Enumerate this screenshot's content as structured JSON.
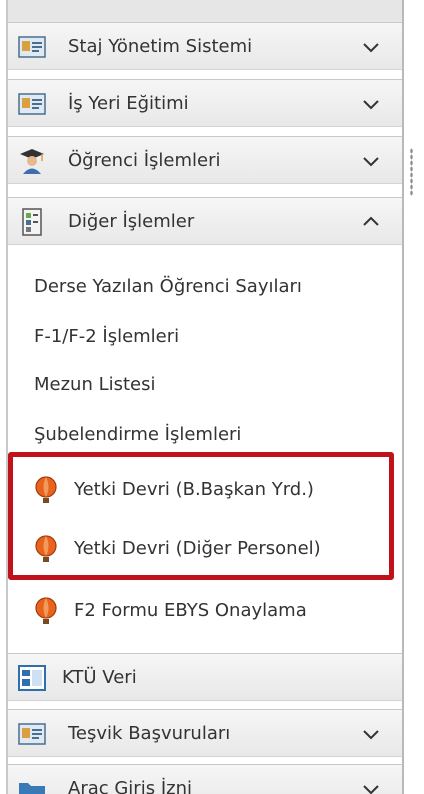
{
  "menu": {
    "sections_top": [
      {
        "label": "Staj Yönetim Sistemi",
        "icon": "card-icon",
        "state": "collapsed"
      },
      {
        "label": "İş Yeri Eğitimi",
        "icon": "card-icon",
        "state": "collapsed"
      },
      {
        "label": "Öğrenci İşlemleri",
        "icon": "graduate-icon",
        "state": "collapsed"
      },
      {
        "label": "Diğer İşlemler",
        "icon": "document-icon",
        "state": "expanded"
      }
    ],
    "items": [
      {
        "label": "Derse Yazılan Öğrenci Sayıları"
      },
      {
        "label": "F-1/F-2 İşlemleri"
      },
      {
        "label": "Mezun Listesi"
      },
      {
        "label": "Şubelendirme İşlemleri"
      },
      {
        "label": "Yetki Devri (B.Başkan Yrd.)",
        "icon": "balloon-icon"
      },
      {
        "label": "Yetki Devri (Diğer Personel)",
        "icon": "balloon-icon"
      },
      {
        "label": "F2 Formu EBYS Onaylama",
        "icon": "balloon-icon"
      }
    ],
    "sections_bottom": [
      {
        "label": "KTÜ Veri",
        "icon": "grid-window-icon"
      },
      {
        "label": "Teşvik Başvuruları",
        "icon": "card-icon",
        "state": "collapsed"
      },
      {
        "label": "Araç Giriş İzni",
        "icon": "folder-icon",
        "state": "collapsed"
      }
    ]
  },
  "colors": {
    "highlight": "#c0121a",
    "balloon": "#e8641e"
  }
}
